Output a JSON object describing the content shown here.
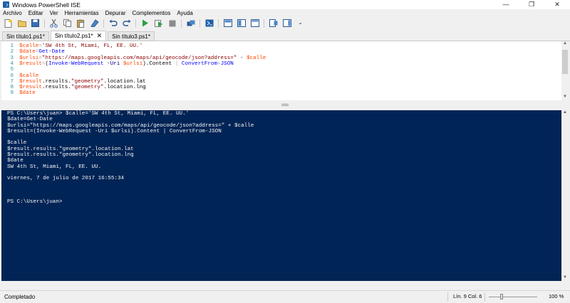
{
  "window": {
    "title": "Windows PowerShell ISE",
    "minimize": "—",
    "maximize": "❐",
    "close": "✕"
  },
  "menu": [
    "Archivo",
    "Editar",
    "Ver",
    "Herramientas",
    "Depurar",
    "Complementos",
    "Ayuda"
  ],
  "toolbar": {
    "icons": [
      "new-file-icon",
      "open-icon",
      "save-icon",
      "cut-icon",
      "copy-icon",
      "paste-icon",
      "clear-console-icon",
      "undo-icon",
      "redo-icon",
      "run-icon",
      "run-selection-icon",
      "stop-icon",
      "new-remote-tab-icon",
      "powershell-icon",
      "show-script-top-icon",
      "show-script-right-icon",
      "show-script-maximized-icon",
      "show-command-window-icon",
      "show-command-addon-icon",
      "overflow-icon"
    ]
  },
  "tabs": [
    {
      "label": "Sin título1.ps1*",
      "active": false
    },
    {
      "label": "Sin título2.ps1*",
      "active": true
    },
    {
      "label": "Sin título3.ps1*",
      "active": false
    }
  ],
  "editor": {
    "lines": [
      {
        "n": "1",
        "tokens": [
          [
            "v",
            "$calle"
          ],
          [
            "o",
            "="
          ],
          [
            "s",
            "'SW 4th St, Miami, FL, EE. UU.'"
          ]
        ]
      },
      {
        "n": "2",
        "tokens": [
          [
            "v",
            "$date"
          ],
          [
            "o",
            "="
          ],
          [
            "c",
            "Get-Date"
          ]
        ]
      },
      {
        "n": "3",
        "tokens": [
          [
            "v",
            "$urlsi"
          ],
          [
            "o",
            "="
          ],
          [
            "s",
            "\"https://maps.googleapis.com/maps/api/geocode/json?address=\""
          ],
          [
            "o",
            " + "
          ],
          [
            "v",
            "$calle"
          ]
        ]
      },
      {
        "n": "4",
        "tokens": [
          [
            "v",
            "$result"
          ],
          [
            "o",
            "="
          ],
          [
            "p",
            "("
          ],
          [
            "c",
            "Invoke-WebRequest"
          ],
          [
            "m",
            " -Uri "
          ],
          [
            "v",
            "$urlsi"
          ],
          [
            "p",
            ")."
          ],
          [
            "p",
            "Content"
          ],
          [
            "o",
            " | "
          ],
          [
            "c",
            "ConvertFrom-JSON"
          ]
        ]
      },
      {
        "n": "5",
        "tokens": []
      },
      {
        "n": "6",
        "tokens": [
          [
            "v",
            "$calle"
          ]
        ]
      },
      {
        "n": "7",
        "tokens": [
          [
            "v",
            "$result"
          ],
          [
            "p",
            ".results."
          ],
          [
            "s",
            "\"geometry\""
          ],
          [
            "p",
            ".location.lat"
          ]
        ]
      },
      {
        "n": "8",
        "tokens": [
          [
            "v",
            "$result"
          ],
          [
            "p",
            ".results."
          ],
          [
            "s",
            "\"geometry\""
          ],
          [
            "p",
            ".location.lng"
          ]
        ]
      },
      {
        "n": "9",
        "tokens": [
          [
            "v",
            "$date"
          ]
        ]
      }
    ]
  },
  "console": {
    "lines": [
      "PS C:\\Users\\juan> $calle='SW 4th St, Miami, FL, EE. UU.'",
      "$date=Get-Date",
      "$urlsi=\"https://maps.googleapis.com/maps/api/geocode/json?address=\" + $calle",
      "$result=(Invoke-WebRequest -Uri $urlsi).Content | ConvertFrom-JSON",
      "",
      "$calle",
      "$result.results.\"geometry\".location.lat",
      "$result.results.\"geometry\".location.lng",
      "$date",
      "SW 4th St, Miami, FL, EE. UU.",
      "",
      "viernes, 7 de julio de 2017 16:55:34",
      "",
      "",
      "",
      "PS C:\\Users\\juan>"
    ]
  },
  "status": {
    "text": "Completado",
    "position": "Lín. 9  Col. 6",
    "zoom": "100 %",
    "zoom_level": 0.26
  }
}
